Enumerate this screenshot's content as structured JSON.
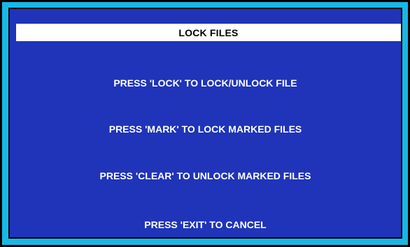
{
  "dialog": {
    "title": "LOCK FILES",
    "instructions": [
      "PRESS 'LOCK' TO LOCK/UNLOCK FILE",
      "PRESS 'MARK' TO LOCK MARKED FILES",
      "PRESS 'CLEAR' TO UNLOCK MARKED FILES",
      "PRESS 'EXIT' TO CANCEL"
    ]
  },
  "colors": {
    "panel_background": "#1f34b8",
    "border_accent": "#17b8e6",
    "title_bar_background": "#ffffff",
    "text": "#ffffff"
  }
}
